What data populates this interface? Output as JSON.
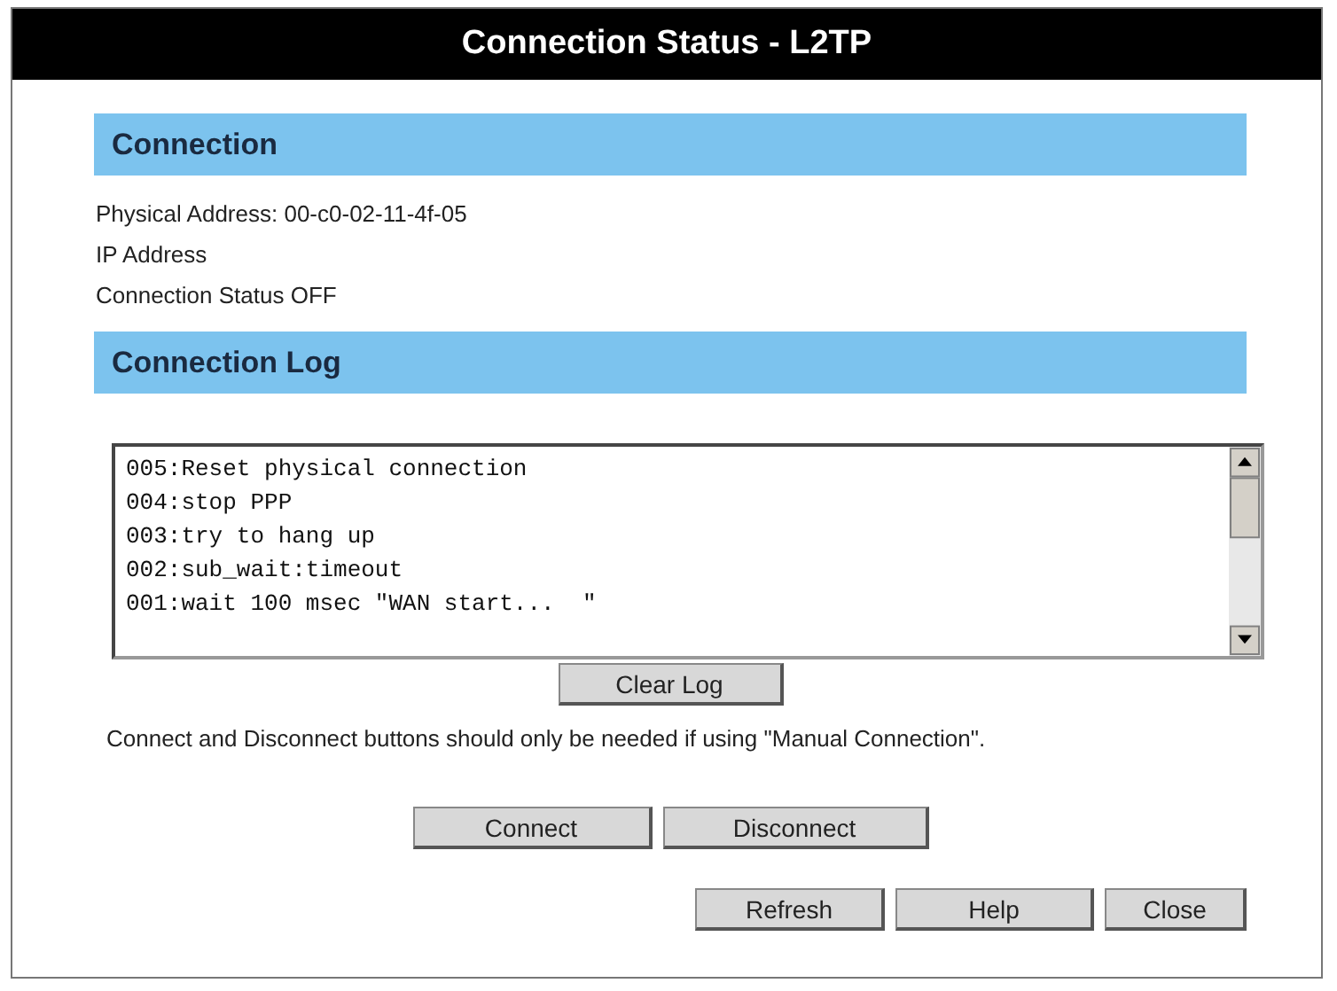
{
  "window": {
    "title": "Connection Status - L2TP"
  },
  "connection": {
    "heading": "Connection",
    "lines": [
      "Physical Address: 00-c0-02-11-4f-05",
      "IP Address",
      "Connection Status OFF"
    ]
  },
  "log": {
    "heading": "Connection Log",
    "lines": [
      "005:Reset physical connection",
      "004:stop PPP",
      "003:try to hang up",
      "002:sub_wait:timeout",
      "001:wait 100 msec \"WAN start...  \""
    ],
    "clear_button": "Clear Log"
  },
  "note": "Connect and Disconnect buttons should only be needed if using \"Manual Connection\".",
  "connect_buttons": [
    "Connect",
    "Disconnect"
  ],
  "footer_buttons": [
    "Refresh",
    "Help",
    "Close"
  ]
}
